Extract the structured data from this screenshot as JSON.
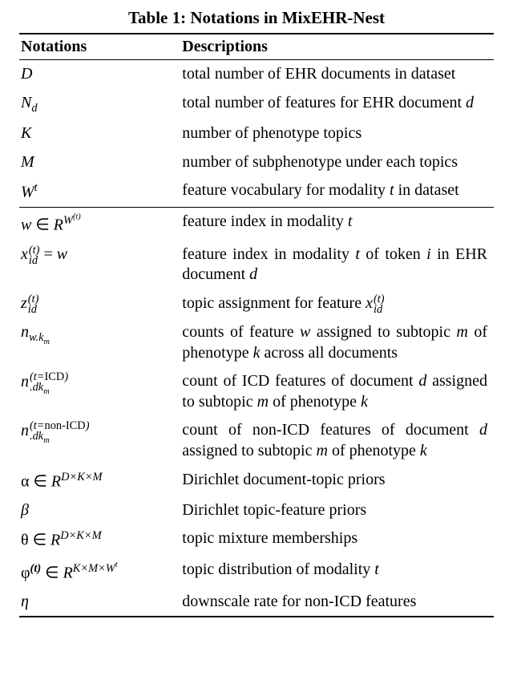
{
  "caption": "Table 1: Notations in MixEHR-Nest",
  "headers": {
    "notation": "Notations",
    "description": "Descriptions"
  },
  "rows": [
    {
      "notation_html": "D",
      "desc": "total number of EHR documents in dataset"
    },
    {
      "notation_html": "N<span class='sub'>d</span>",
      "desc": "total number of features for EHR document <i>d</i>"
    },
    {
      "notation_html": "K",
      "desc": "number of phenotype topics"
    },
    {
      "notation_html": "M",
      "desc": "number of subphenotype under each topics"
    },
    {
      "notation_html": "W<span class='sup'>t</span>",
      "desc": "feature vocabulary for modality <i>t</i> in dataset"
    },
    {
      "sep": true,
      "notation_html": "w <span class='rm'>∈</span> R<span class='sup'>W<span class='sup'>(t)</span></span>",
      "desc": "feature index in modality <i>t</i>"
    },
    {
      "notation_html": "x<span class='nest-sup-sub'><span class='top'>(t)</span><span class='bot'>id</span></span> <span class='rm'>=</span> w",
      "desc": "feature index in modality <i>t</i> of token <i>i</i> in EHR document <i>d</i>"
    },
    {
      "notation_html": "z<span class='nest-sup-sub'><span class='top'>(t)</span><span class='bot'>id</span></span>",
      "desc": "topic assignment for feature <i>x</i><span class='nest-sup-sub'><span class='top'>(t)</span><span class='bot'>id</span></span>"
    },
    {
      "notation_html": "n<span class='sub'>w.k<span class='sub'>m</span></span>",
      "desc": "counts of feature <i>w</i> assigned to subtopic <i>m</i> of phenotype <i>k</i> across all documents"
    },
    {
      "notation_html": "n<span class='nest-sup-sub'><span class='top'>(t=<span class=\"rm\">ICD</span>)</span><span class='bot'>.dk<span class=\"sub\">m</span></span></span>",
      "desc": "count of ICD features of document <i>d</i> assigned to subtopic <i>m</i> of phenotype <i>k</i>"
    },
    {
      "notation_html": "n<span class='nest-sup-sub'><span class='top'>(t=<span class=\"rm\">non-ICD</span>)</span><span class='bot'>.dk<span class=\"sub\">m</span></span></span>",
      "desc": "count of non-ICD features of document <i>d</i> assigned to subtopic <i>m</i> of phenotype <i>k</i>"
    },
    {
      "notation_html": "<span class='rm'>α</span> <span class='rm'>∈</span> R<span class='sup'>D×K×M</span>",
      "desc": "Dirichlet document-topic priors"
    },
    {
      "notation_html": "β",
      "desc": "Dirichlet topic-feature priors"
    },
    {
      "notation_html": "<span class='rm'>θ</span> <span class='rm'>∈</span> R<span class='sup'>D×K×M</span>",
      "desc": "topic mixture memberships"
    },
    {
      "notation_html": "<span class='rm'>φ</span><span class='sup'><b>(t)</b></span> <span class='rm'>∈</span> R<span class='sup'>K×M×W<span class='sup'>t</span></span>",
      "desc": "topic distribution of modality <i>t</i>"
    },
    {
      "last": true,
      "notation_html": "η",
      "desc": "downscale rate for non-ICD features"
    }
  ]
}
